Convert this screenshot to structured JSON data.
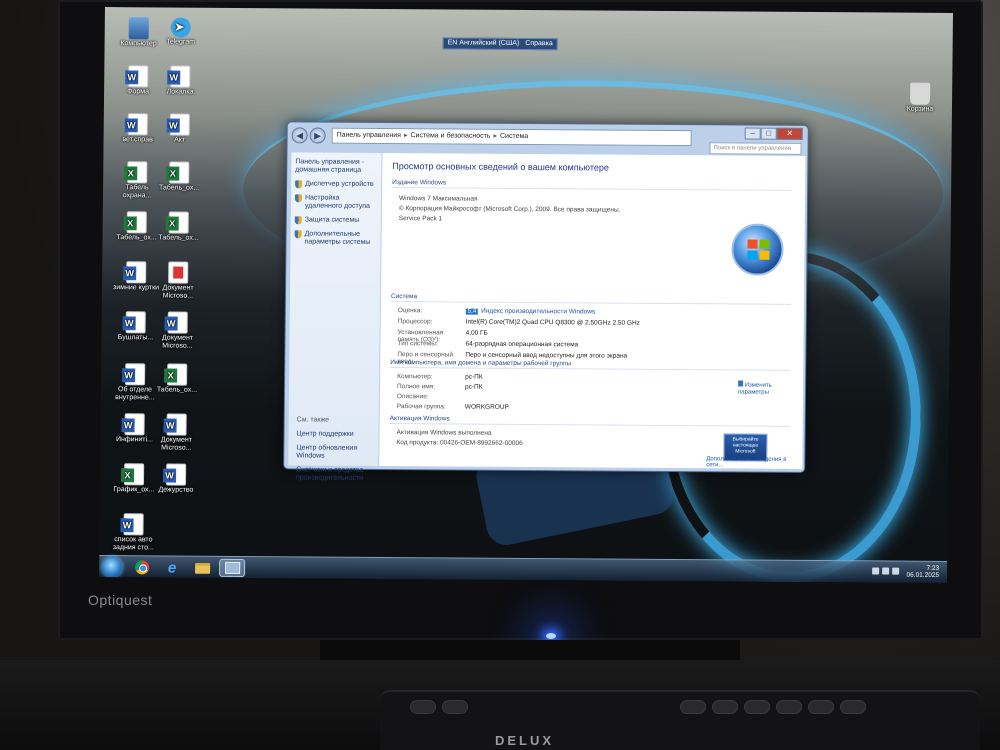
{
  "monitor_brand": "Optiquest",
  "keyboard_brand": "DELUX",
  "lang_bar": {
    "language": "EN Английский (США)",
    "help": "Справка"
  },
  "desktop_icons": [
    {
      "label": "Компьютер",
      "type": "computer"
    },
    {
      "label": "Telegram",
      "type": "telegram"
    },
    {
      "label": "Форма",
      "type": "word"
    },
    {
      "label": "Локалка",
      "type": "word"
    },
    {
      "label": "вет.справ",
      "type": "word"
    },
    {
      "label": "Акт",
      "type": "word"
    },
    {
      "label": "Табель охрана...",
      "type": "excel"
    },
    {
      "label": "Табель_ох...",
      "type": "excel"
    },
    {
      "label": "Табель_ох...",
      "type": "excel"
    },
    {
      "label": "Табель_ох...",
      "type": "excel"
    },
    {
      "label": "зимние куртки",
      "type": "word"
    },
    {
      "label": "Документ Microso...",
      "type": "pdf"
    },
    {
      "label": "Бушлаты...",
      "type": "word"
    },
    {
      "label": "Документ Microso...",
      "type": "word"
    },
    {
      "label": "Об отделе внутренне...",
      "type": "word"
    },
    {
      "label": "Табель_ох...",
      "type": "excel"
    },
    {
      "label": "Инфиниті...",
      "type": "word"
    },
    {
      "label": "Документ Microso...",
      "type": "word"
    },
    {
      "label": "График_ох...",
      "type": "excel"
    },
    {
      "label": "Дежурство",
      "type": "word"
    },
    {
      "label": "список авто задния сто...",
      "type": "word"
    },
    {
      "label": "Корзина",
      "type": "bin"
    }
  ],
  "window": {
    "breadcrumb": [
      "Панель управления",
      "Система и безопасность",
      "Система"
    ],
    "search_placeholder": "Поиск в панели управления",
    "left_pane": {
      "home": "Панель управления - домашняя страница",
      "links": [
        "Диспетчер устройств",
        "Настройка удаленного доступа",
        "Защита системы",
        "Дополнительные параметры системы"
      ],
      "see_also_title": "См. также",
      "see_also": [
        "Центр поддержки",
        "Центр обновления Windows",
        "Счетчики и средства производительности"
      ]
    },
    "header": "Просмотр основных сведений о вашем компьютере",
    "edition_section": "Издание Windows",
    "edition": [
      "Windows 7 Максимальная",
      "© Корпорация Майкрософт (Microsoft Corp.), 2009. Все права защищены.",
      "Service Pack 1"
    ],
    "system_section": "Система",
    "system_rows": [
      {
        "key": "Оценка:",
        "value": "Индекс производительности Windows",
        "badge": "5,4"
      },
      {
        "key": "Процессор:",
        "value": "Intel(R) Core(TM)2 Quad CPU    Q8300  @ 2.50GHz   2.50 GHz"
      },
      {
        "key": "Установленная память (ОЗУ):",
        "value": "4,00 ГБ"
      },
      {
        "key": "Тип системы:",
        "value": "64-разрядная операционная система"
      },
      {
        "key": "Перо и сенсорный ввод:",
        "value": "Перо и сенсорный ввод недоступны для этого экрана"
      }
    ],
    "computer_section": "Имя компьютера, имя домена и параметры рабочей группы",
    "computer_rows": [
      {
        "key": "Компьютер:",
        "value": "pc-ПК"
      },
      {
        "key": "Полное имя:",
        "value": "pc-ПК"
      },
      {
        "key": "Описание:",
        "value": ""
      },
      {
        "key": "Рабочая группа:",
        "value": "WORKGROUP"
      }
    ],
    "change_params": "Изменить параметры",
    "activation_section": "Активация Windows",
    "activation_rows": [
      "Активация Windows выполнена",
      "Код продукта: 00426-OEM-8992662-00006"
    ],
    "genuine_badge": "Выбирайте настоящее Microsoft",
    "more_info": "Дополнительные сведения в сети..."
  },
  "taskbar": {
    "time": "7:23",
    "date": "06.01.2025"
  }
}
